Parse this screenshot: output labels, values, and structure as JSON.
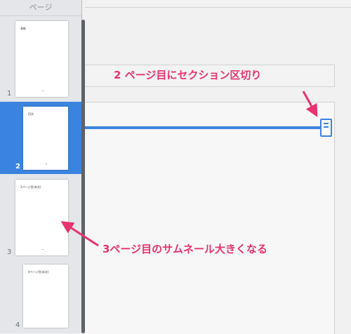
{
  "sidebar": {
    "header": "ページ",
    "pages": [
      {
        "number": "1",
        "title": "表紙"
      },
      {
        "number": "2",
        "title": "目次"
      },
      {
        "number": "3",
        "title": "3ページ目(本文)"
      },
      {
        "number": "4",
        "title": "4ページ目(本文)"
      }
    ]
  },
  "annotations": {
    "section_break": "2 ページ目にセクション区切り",
    "thumbnail_larger": "3ページ目のサムネール大きくなる"
  },
  "colors": {
    "accent": "#3a84e0",
    "annotation": "#e8336f"
  }
}
